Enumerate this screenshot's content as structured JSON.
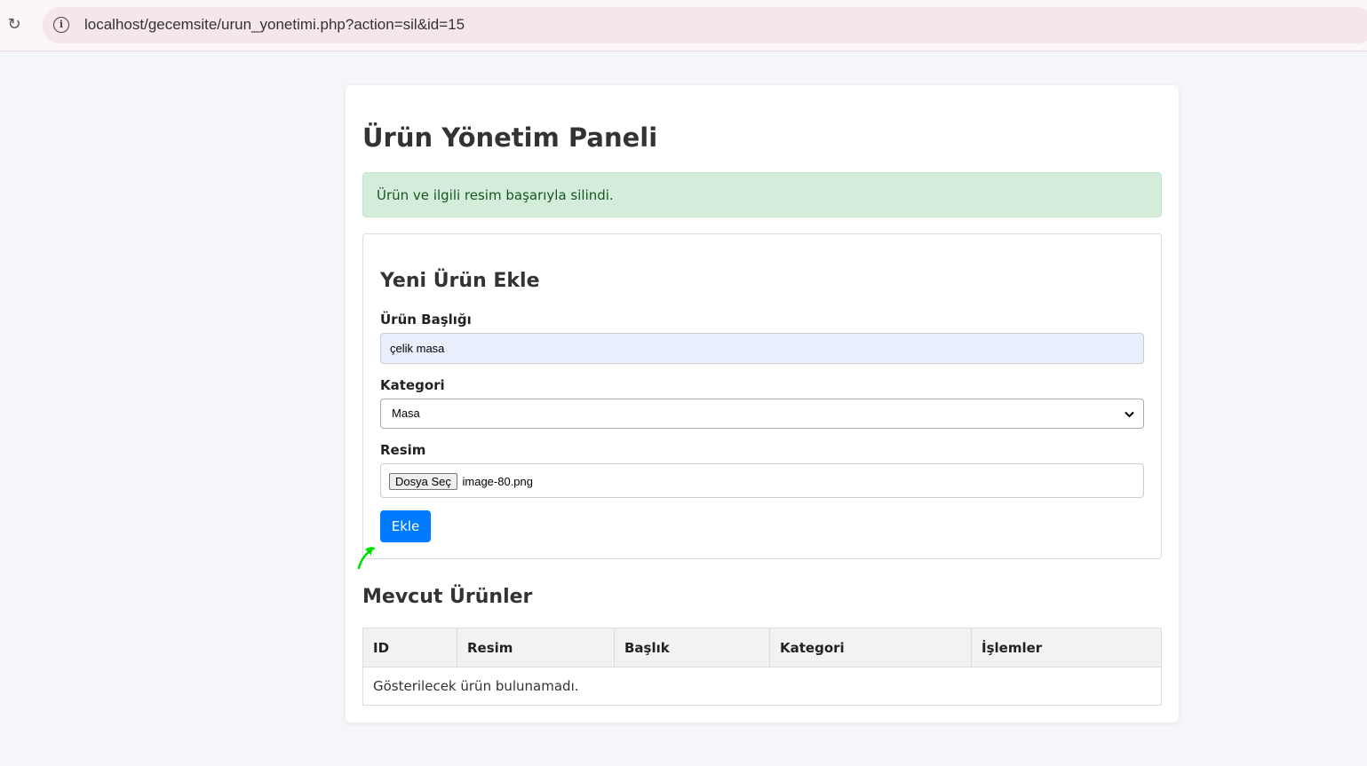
{
  "browser": {
    "url": "localhost/gecemsite/urun_yonetimi.php?action=sil&id=15",
    "reload_icon": "reload-icon",
    "info_icon": "info-icon"
  },
  "page": {
    "title": "Ürün Yönetim Paneli",
    "alert": "Ürün ve ilgili resim başarıyla silindi."
  },
  "form": {
    "title": "Yeni Ürün Ekle",
    "title_label": "Ürün Başlığı",
    "title_value": "çelik masa",
    "category_label": "Kategori",
    "category_value": "Masa",
    "image_label": "Resim",
    "file_button": "Dosya Seç",
    "file_name": "image-80.png",
    "submit": "Ekle"
  },
  "products": {
    "title": "Mevcut Ürünler",
    "columns": [
      "ID",
      "Resim",
      "Başlık",
      "Kategori",
      "İşlemler"
    ],
    "empty_message": "Gösterilecek ürün bulunamadı."
  },
  "colors": {
    "accent": "#007bff",
    "alert_bg": "#d4edda",
    "alert_text": "#155724",
    "cursor": "#00e000"
  }
}
